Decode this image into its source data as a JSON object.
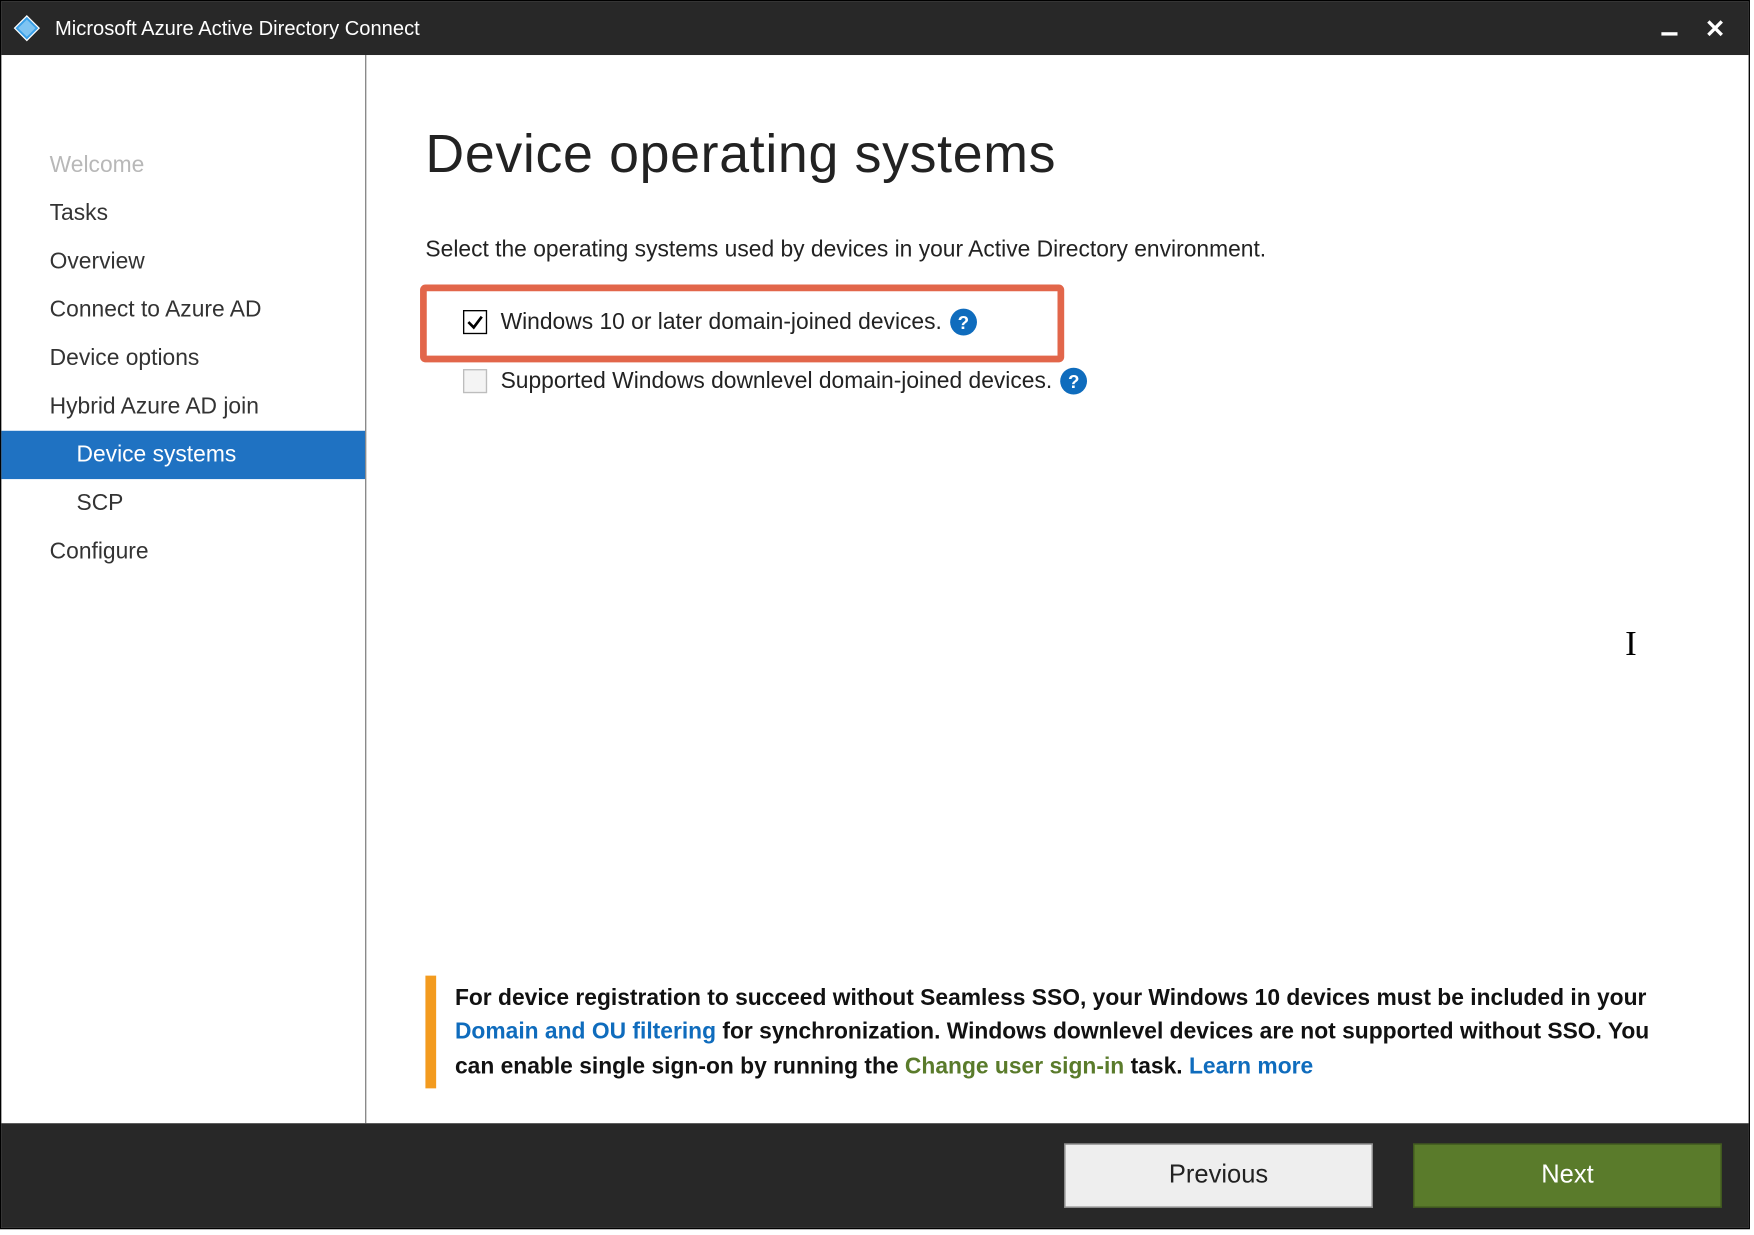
{
  "titlebar": {
    "title": "Microsoft Azure Active Directory Connect"
  },
  "sidebar": {
    "items": [
      {
        "label": "Welcome",
        "state": "disabled"
      },
      {
        "label": "Tasks",
        "state": "normal"
      },
      {
        "label": "Overview",
        "state": "normal"
      },
      {
        "label": "Connect to Azure AD",
        "state": "normal"
      },
      {
        "label": "Device options",
        "state": "normal"
      },
      {
        "label": "Hybrid Azure AD join",
        "state": "normal"
      },
      {
        "label": "Device systems",
        "state": "selected",
        "sub": true
      },
      {
        "label": "SCP",
        "state": "normal",
        "sub": true
      },
      {
        "label": "Configure",
        "state": "normal"
      }
    ]
  },
  "main": {
    "heading": "Device operating systems",
    "subtitle": "Select the operating systems used by devices in your Active Directory environment.",
    "options": [
      {
        "label": "Windows 10 or later domain-joined devices.",
        "checked": true,
        "highlighted": true
      },
      {
        "label": "Supported Windows downlevel domain-joined devices.",
        "checked": false,
        "highlighted": false
      }
    ],
    "notice": {
      "pre": "For device registration to succeed without Seamless SSO, your Windows 10 devices must be included in your ",
      "link1": "Domain and OU filtering",
      "mid": " for synchronization.  Windows downlevel devices are not supported without SSO.  You can enable single sign-on by running the ",
      "link2": "Change user sign-in",
      "post": " task. ",
      "learn": "Learn more"
    }
  },
  "footer": {
    "previous": "Previous",
    "next": "Next"
  }
}
